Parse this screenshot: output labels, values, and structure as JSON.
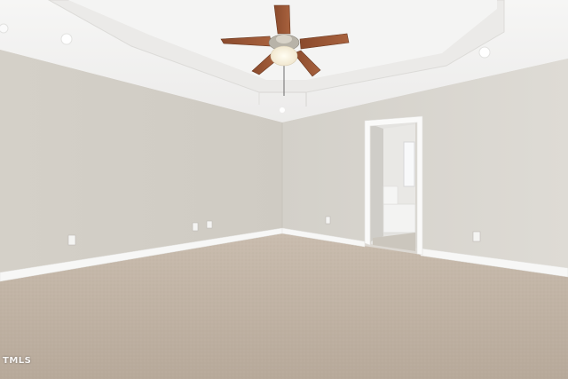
{
  "scene": {
    "watermark": "TMLS"
  }
}
